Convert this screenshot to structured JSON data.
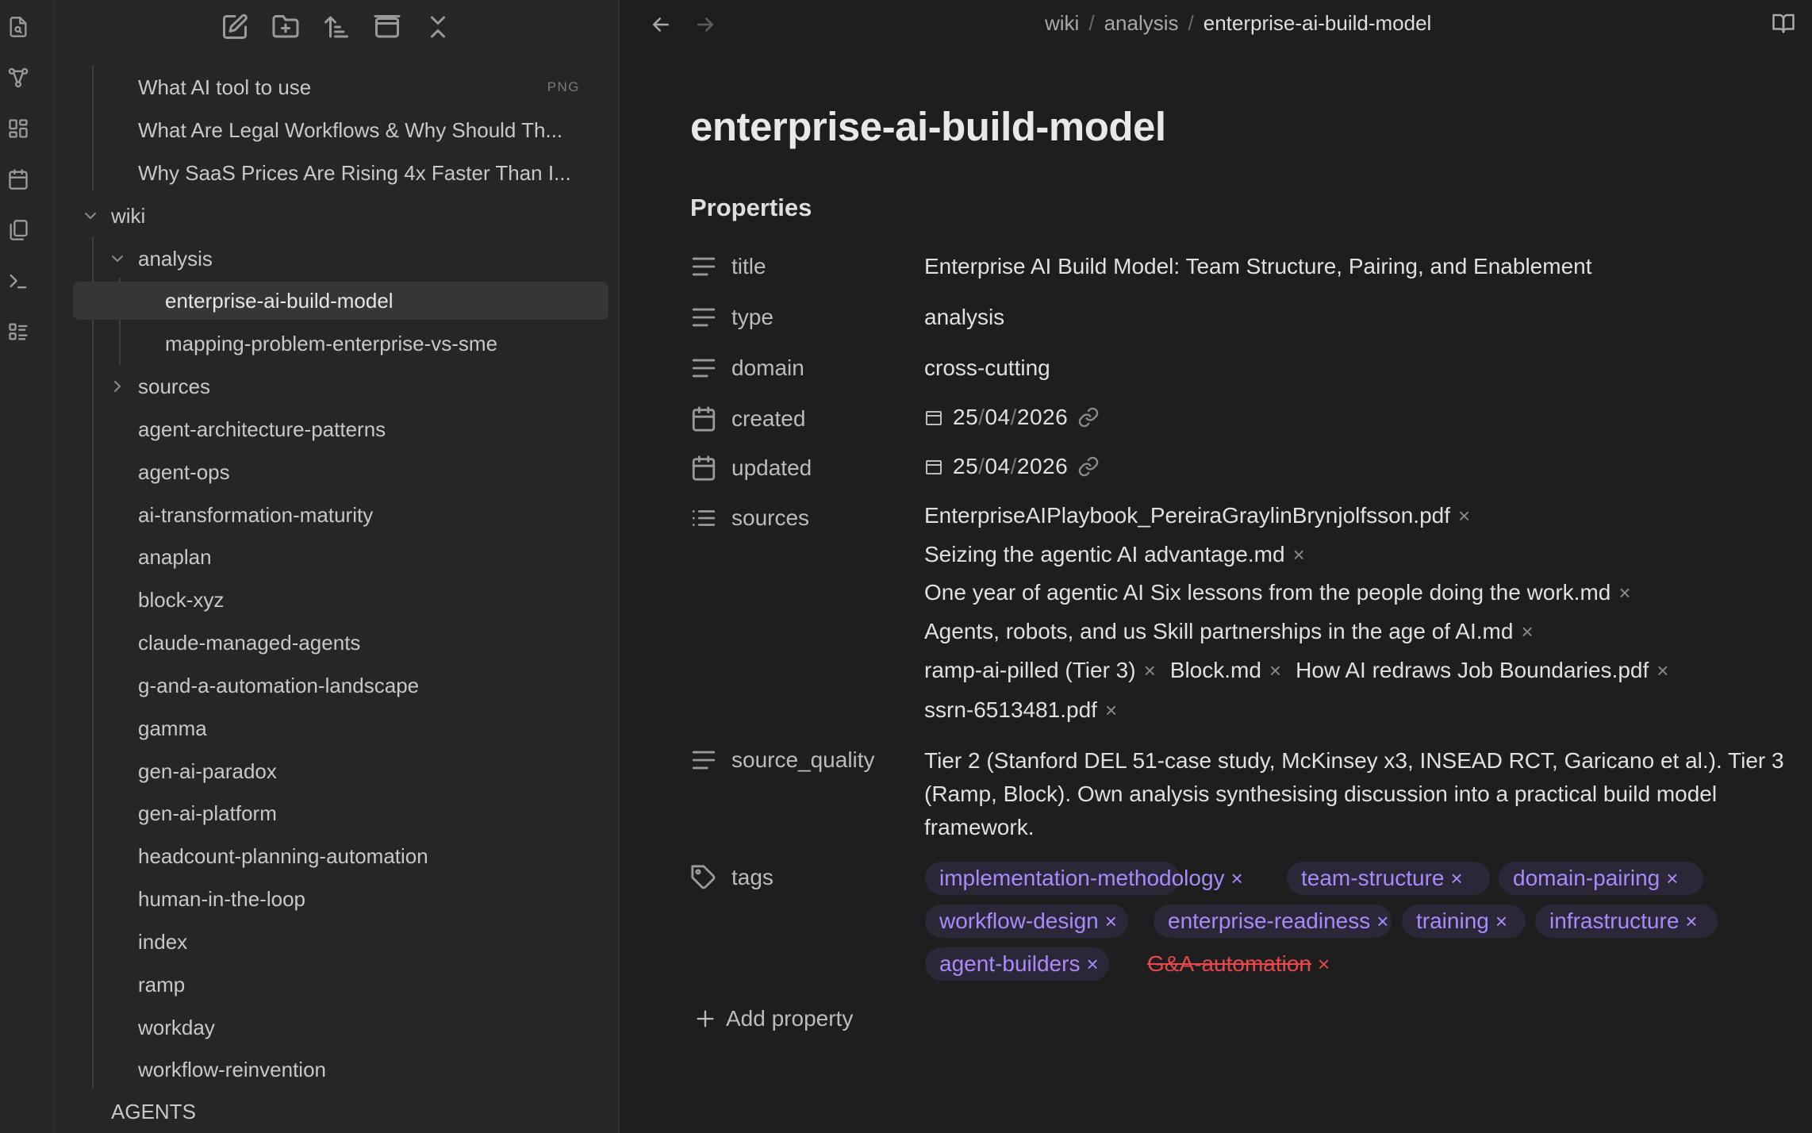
{
  "sidebar_toolbar": {
    "icons": [
      "new-note-icon",
      "new-folder-icon",
      "sort-icon",
      "auto-reveal-icon",
      "collapse-all-icon"
    ]
  },
  "ribbon": {
    "icons": [
      "quick-switcher-icon",
      "graph-view-icon",
      "canvas-icon",
      "daily-note-icon",
      "templates-icon",
      "terminal-icon",
      "bases-icon"
    ]
  },
  "tree": {
    "items": [
      {
        "label": "What AI tool to use",
        "badge": "PNG"
      },
      {
        "label": "What Are Legal Workflows & Why Should Th..."
      },
      {
        "label": "Why SaaS Prices Are Rising 4x Faster Than I..."
      },
      {
        "label": "wiki"
      },
      {
        "label": "analysis"
      },
      {
        "label": "enterprise-ai-build-model"
      },
      {
        "label": "mapping-problem-enterprise-vs-sme"
      },
      {
        "label": "sources"
      },
      {
        "label": "agent-architecture-patterns"
      },
      {
        "label": "agent-ops"
      },
      {
        "label": "ai-transformation-maturity"
      },
      {
        "label": "anaplan"
      },
      {
        "label": "block-xyz"
      },
      {
        "label": "claude-managed-agents"
      },
      {
        "label": "g-and-a-automation-landscape"
      },
      {
        "label": "gamma"
      },
      {
        "label": "gen-ai-paradox"
      },
      {
        "label": "gen-ai-platform"
      },
      {
        "label": "headcount-planning-automation"
      },
      {
        "label": "human-in-the-loop"
      },
      {
        "label": "index"
      },
      {
        "label": "ramp"
      },
      {
        "label": "workday"
      },
      {
        "label": "workflow-reinvention"
      },
      {
        "label": "AGENTS"
      }
    ]
  },
  "breadcrumb": {
    "parts": [
      "wiki",
      "analysis",
      "enterprise-ai-build-model"
    ],
    "separator": "/"
  },
  "note": {
    "title": "enterprise-ai-build-model",
    "properties_heading": "Properties",
    "properties": {
      "title": {
        "key": "title",
        "value": "Enterprise AI Build Model: Team Structure, Pairing, and Enablement"
      },
      "type": {
        "key": "type",
        "value": "analysis"
      },
      "domain": {
        "key": "domain",
        "value": "cross-cutting"
      },
      "created": {
        "key": "created",
        "day": "25",
        "month": "04",
        "year": "2026",
        "sep": "/"
      },
      "updated": {
        "key": "updated",
        "day": "25",
        "month": "04",
        "year": "2026",
        "sep": "/"
      },
      "sources": {
        "key": "sources",
        "items": [
          "EnterpriseAIPlaybook_PereiraGraylinBrynjolfsson.pdf",
          "Seizing the agentic AI advantage.md",
          "One year of agentic AI Six lessons from the people doing the work.md",
          "Agents, robots, and us Skill partnerships in the age of AI.md",
          "ramp-ai-pilled (Tier 3)",
          "Block.md",
          "How AI redraws Job Boundaries.pdf",
          "ssrn-6513481.pdf"
        ]
      },
      "source_quality": {
        "key": "source_quality",
        "value": "Tier 2 (Stanford DEL 51-case study, McKinsey x3, INSEAD RCT, Garicano et al.). Tier 3 (Ramp, Block). Own analysis synthesising discussion into a practical build model framework."
      },
      "tags": {
        "key": "tags",
        "items": [
          "implementation-methodology",
          "team-structure",
          "domain-pairing",
          "workflow-design",
          "enterprise-readiness",
          "training",
          "infrastructure",
          "agent-builders",
          "G&A-automation"
        ]
      }
    },
    "remove_glyph": "×",
    "add_property_label": "Add property"
  },
  "colors": {
    "tag_text": "#a88bfa",
    "tag_bg": "#2c2738",
    "invalid_tag": "#e5484d",
    "active_item_bg": "#363636"
  }
}
